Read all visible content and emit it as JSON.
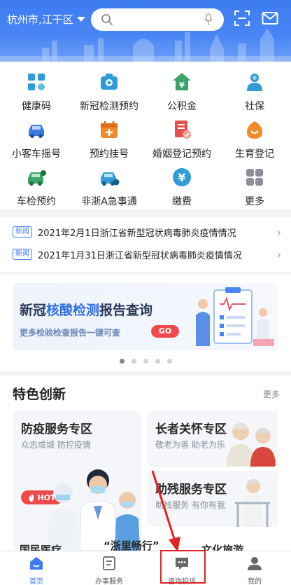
{
  "header": {
    "city": "杭州市,江干区",
    "icons": [
      "chevron-down-icon",
      "search-icon",
      "microphone-icon",
      "scan-icon",
      "mail-icon"
    ]
  },
  "services": [
    {
      "label": "健康码",
      "icon": "health-code-icon",
      "color": "#2f9bd8"
    },
    {
      "label": "新冠检测预约",
      "icon": "test-kit-icon",
      "color": "#2f9bd8"
    },
    {
      "label": "公积金",
      "icon": "housing-fund-icon",
      "color": "#3aa568"
    },
    {
      "label": "社保",
      "icon": "social-security-icon",
      "color": "#2f9bd8"
    },
    {
      "label": "小客车摇号",
      "icon": "car-icon",
      "color": "#3a7be0"
    },
    {
      "label": "预约挂号",
      "icon": "calendar-icon",
      "color": "#f08a2a"
    },
    {
      "label": "婚姻登记预约",
      "icon": "marriage-icon",
      "color": "#e2524a"
    },
    {
      "label": "生育登记",
      "icon": "birth-icon",
      "color": "#f08a2a"
    },
    {
      "label": "车检预约",
      "icon": "car-inspection-icon",
      "color": "#3aa568"
    },
    {
      "label": "非浙A急事通",
      "icon": "car-plate-icon",
      "color": "#2f9bd8"
    },
    {
      "label": "缴费",
      "icon": "payment-icon",
      "color": "#2f9bd8"
    },
    {
      "label": "更多",
      "icon": "more-grid-icon",
      "color": "#8a8f99"
    }
  ],
  "news": {
    "tag": "新闻",
    "items": [
      "2021年2月1日浙江省新型冠状病毒肺炎疫情情况",
      "2021年1月31日浙江省新型冠状病毒肺炎疫情情况"
    ]
  },
  "banner": {
    "title_a": "新冠",
    "title_b": "核酸检测",
    "title_c": "报告查询",
    "subtitle": "更多检验检查报告一键可查",
    "go": "GO",
    "page_count": 5,
    "active_page": 1
  },
  "featured": {
    "title": "特色创新",
    "more": "更多",
    "cards": [
      {
        "title": "防疫服务专区",
        "subtitle": "众志成城 防控疫情",
        "badge": "HOT"
      },
      {
        "title": "长者关怀专区",
        "subtitle": "敬老为善 助老为乐"
      },
      {
        "title": "助残服务专区",
        "subtitle": "助残服务 有你有我"
      }
    ],
    "peek": [
      "国民医疗",
      "“浙里畅行”",
      "文化旅游"
    ]
  },
  "tabs": [
    {
      "label": "首页",
      "icon": "home-icon",
      "active": true
    },
    {
      "label": "办事服务",
      "icon": "document-icon",
      "active": false
    },
    {
      "label": "咨询投诉",
      "icon": "chat-icon",
      "active": false
    },
    {
      "label": "我的",
      "icon": "profile-icon",
      "active": false
    }
  ],
  "colors": {
    "primary": "#3d7bf2",
    "accent_red": "#ef4a4a",
    "annotation": "#e52222"
  }
}
